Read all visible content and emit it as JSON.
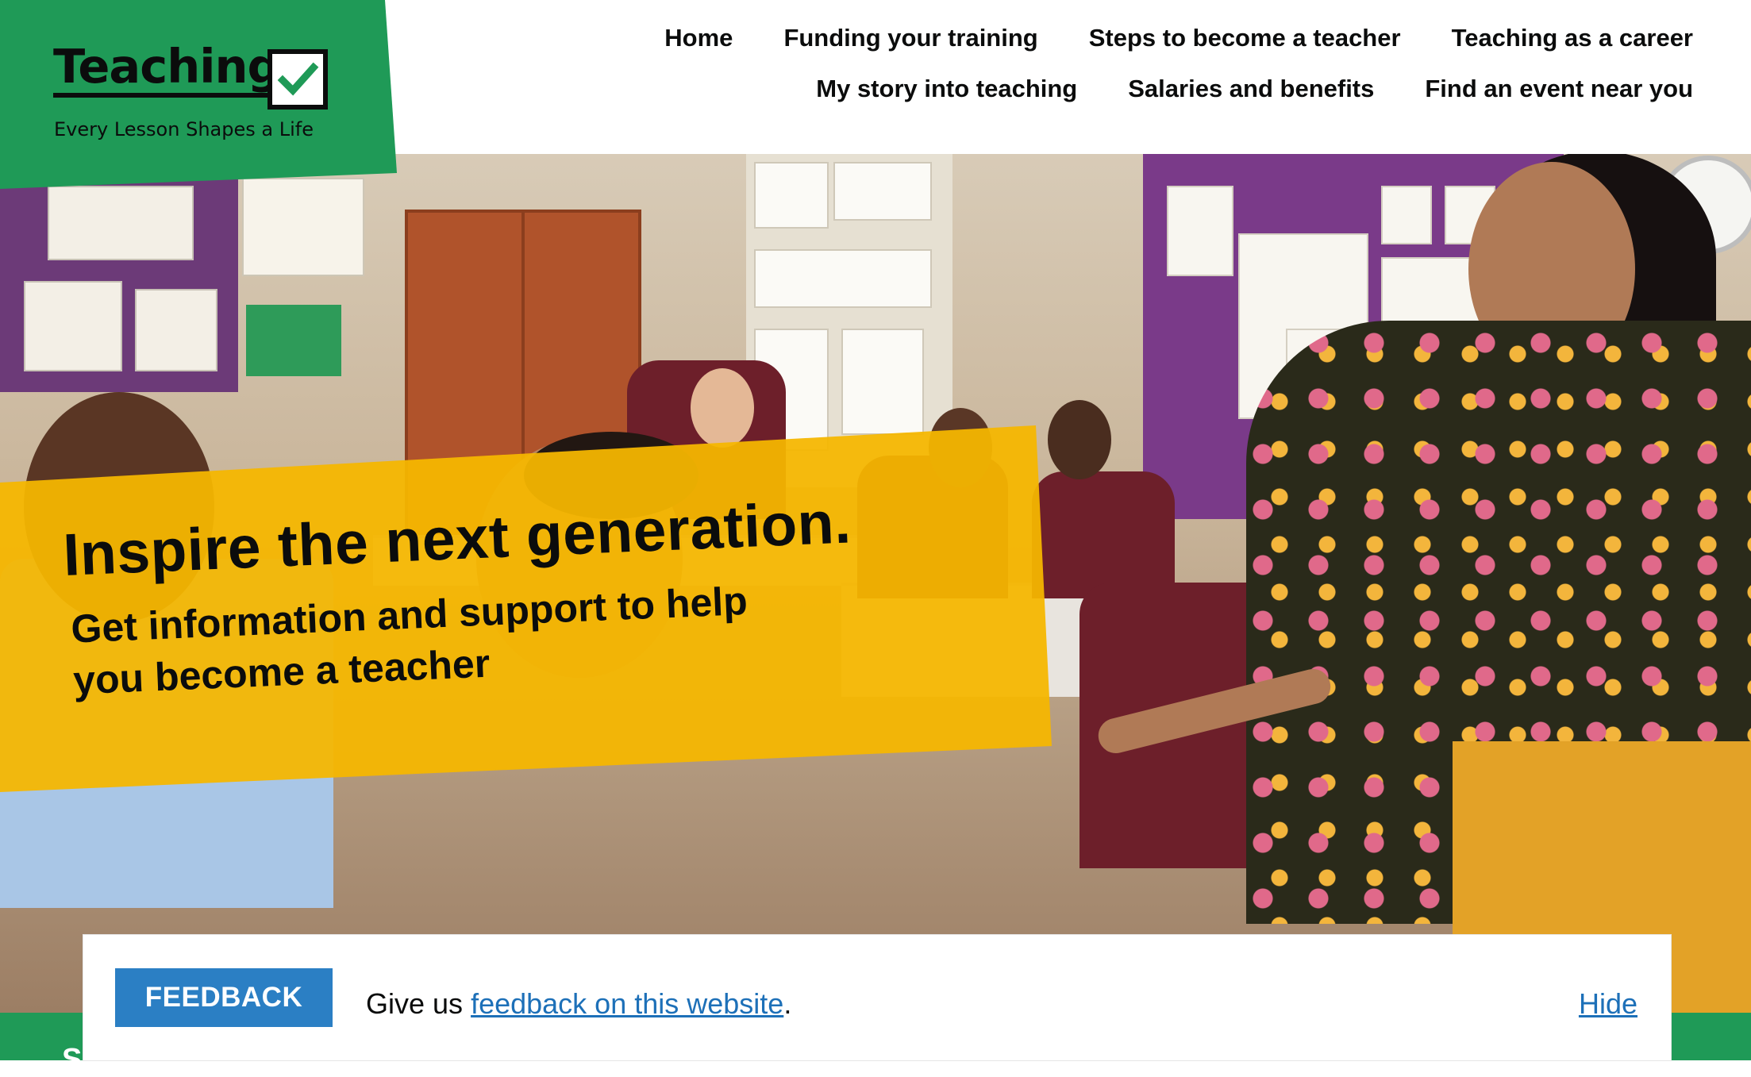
{
  "logo": {
    "word": "Teaching",
    "tagline": "Every Lesson Shapes a Life",
    "check_icon": "check-icon"
  },
  "nav": {
    "row1": [
      "Home",
      "Funding your training",
      "Steps to become a teacher",
      "Teaching as a career"
    ],
    "row2": [
      "My story into teaching",
      "Salaries and benefits",
      "Find an event near you"
    ]
  },
  "hero": {
    "title": "Inspire the next generation.",
    "subtitle": "Get information and support to help you become a teacher",
    "image": "classroom-photo"
  },
  "feedback": {
    "button": "FEEDBACK",
    "text_prefix": "Give us",
    "link": "feedback on this website",
    "text_suffix": ".",
    "hide": "Hide"
  },
  "green_strip": {
    "letter": "S"
  },
  "colors": {
    "brand_green": "#1f9a57",
    "banner_yellow": "#f5b700",
    "feedback_blue": "#2b7fc4",
    "link_blue": "#1d70b8",
    "text": "#0b0c0c"
  }
}
